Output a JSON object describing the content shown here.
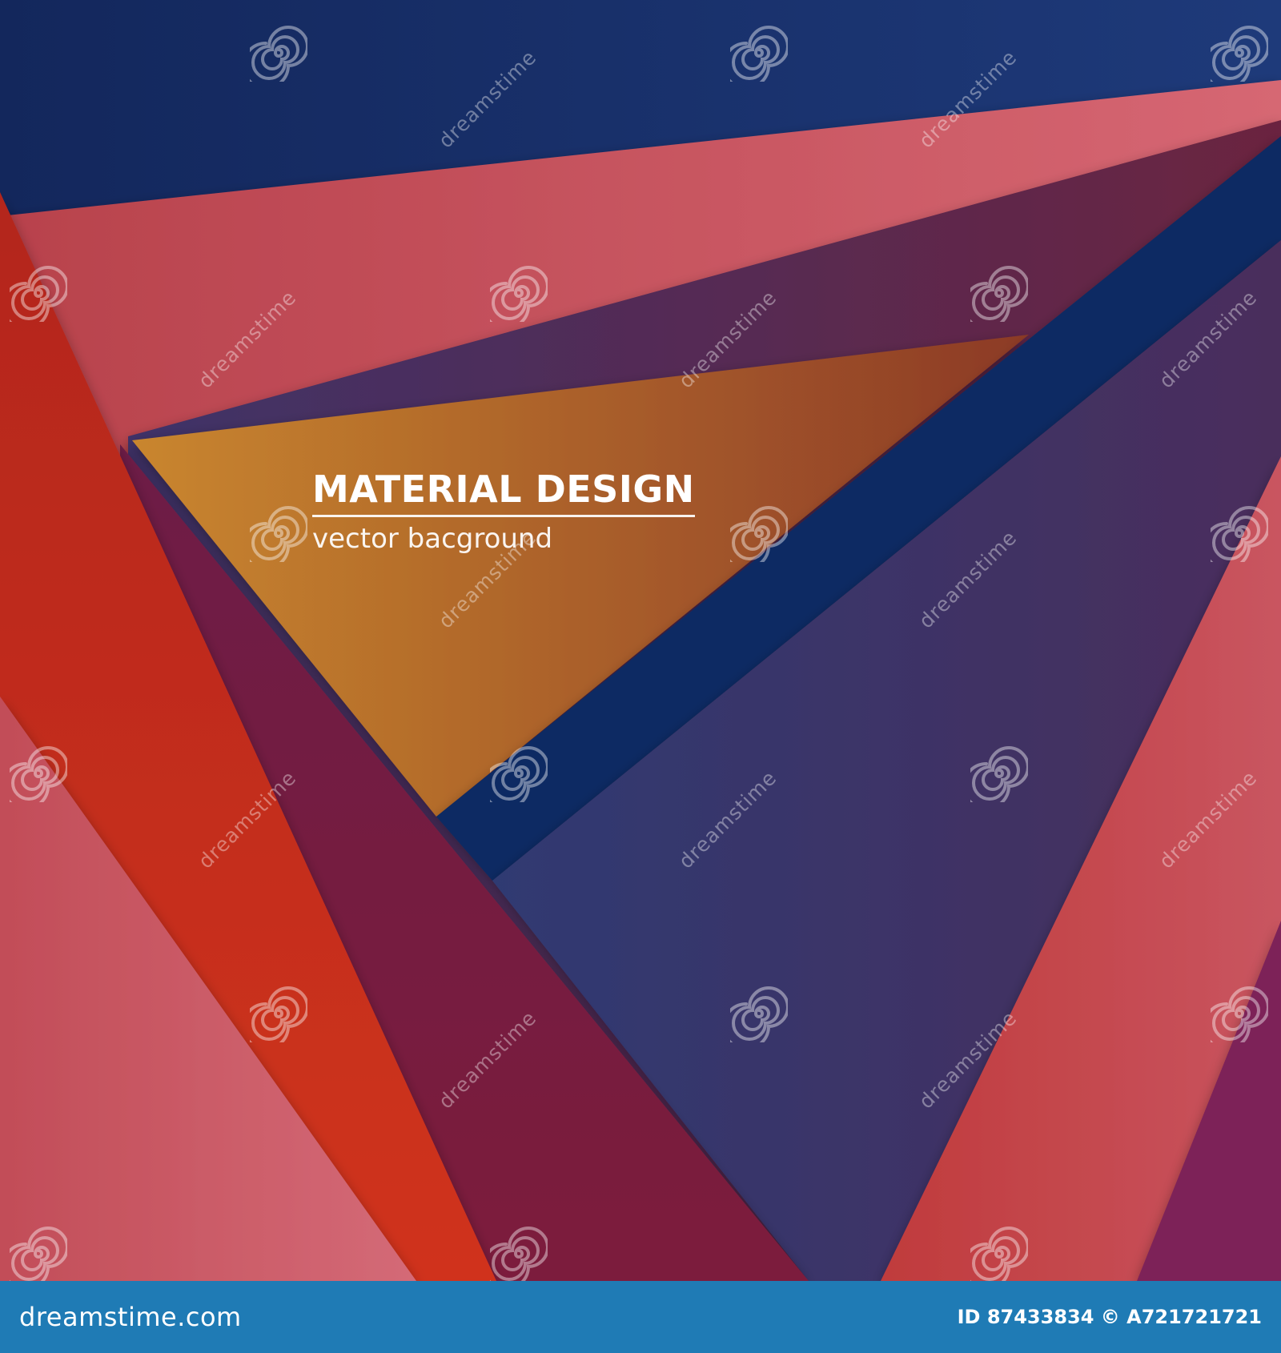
{
  "headline": {
    "title": "MATERIAL DESIGN",
    "subtitle": "vector bacground"
  },
  "watermark": {
    "text": "dreamstime",
    "icon": "spiral-logo-icon"
  },
  "footer": {
    "site": "dreamstime.com",
    "id_text": "ID 87433834 © A721721721",
    "background": "#1f7bb5"
  },
  "palette": {
    "navy": "#1e2f63",
    "rose": "#c9525e",
    "red": "#bf2a1e",
    "wine": "#7a1f45",
    "amber": "#b86f2a",
    "violet": "#3d3a6e",
    "magenta": "#7d2258"
  }
}
